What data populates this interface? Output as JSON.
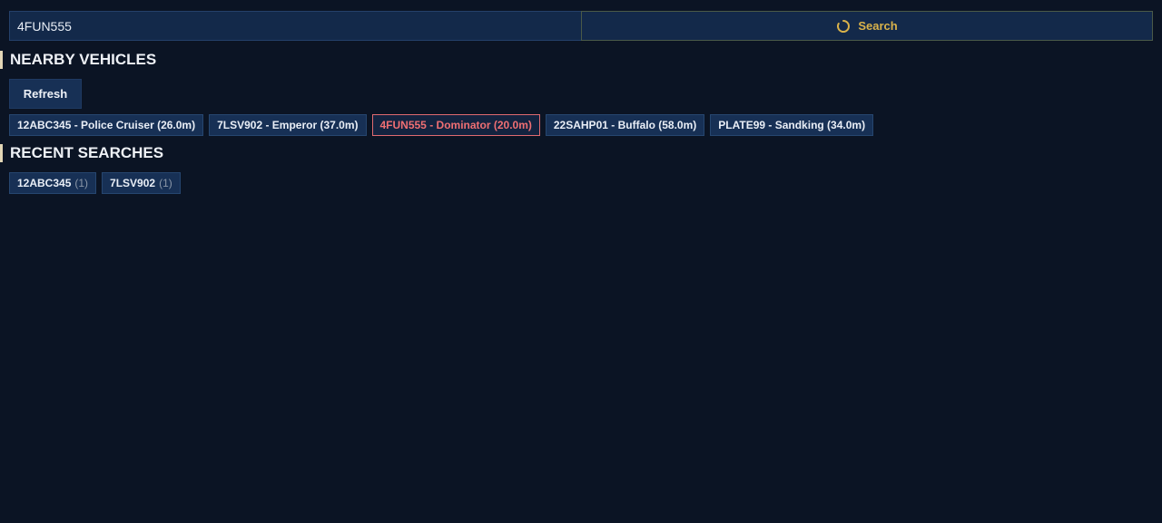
{
  "search": {
    "value": "4FUN555",
    "button_label": "Search",
    "button_icon": "spinner-icon",
    "accent_color": "#d9b24a"
  },
  "nearby": {
    "title": "NEARBY VEHICLES",
    "refresh_label": "Refresh",
    "vehicles": [
      {
        "label": "12ABC345 - Police Cruiser (26.0m)",
        "active": false
      },
      {
        "label": "7LSV902 - Emperor (37.0m)",
        "active": false
      },
      {
        "label": "4FUN555 - Dominator (20.0m)",
        "active": true
      },
      {
        "label": "22SAHP01 - Buffalo (58.0m)",
        "active": false
      },
      {
        "label": "PLATE99 - Sandking (34.0m)",
        "active": false
      }
    ],
    "active_color": "#ef6f73"
  },
  "recent": {
    "title": "RECENT SEARCHES",
    "items": [
      {
        "plate": "12ABC345",
        "count": "(1)"
      },
      {
        "plate": "7LSV902",
        "count": "(1)"
      }
    ]
  }
}
